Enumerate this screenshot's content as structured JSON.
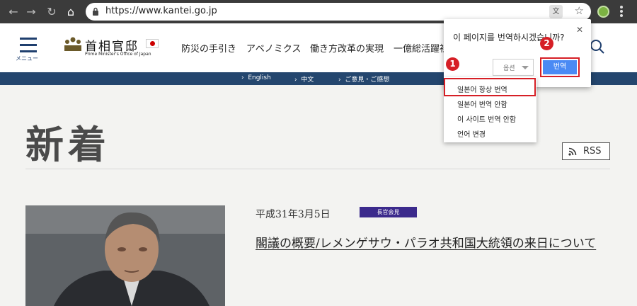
{
  "browser": {
    "url": "https://www.kantei.go.jp",
    "back_icon": "back-arrow-icon",
    "forward_icon": "forward-arrow-icon",
    "reload_icon": "reload-icon",
    "home_icon": "home-icon"
  },
  "header": {
    "menu_label": "メニュー",
    "logo_title": "首相官邸",
    "logo_subtitle": "Prime Minister's Office of Japan",
    "nav": [
      "防災の手引き",
      "アベノミクス",
      "働き方改革の実現",
      "一億総活躍社"
    ]
  },
  "subbar": {
    "links": [
      "English",
      "中文",
      "ご意見・ご感想"
    ]
  },
  "page": {
    "title": "新着",
    "rss_label": "RSS",
    "news": {
      "date": "平成31年3月5日",
      "tag": "長官会見",
      "title": "閣議の概要/レメンゲサウ・パラオ共和国大統領の来日について"
    }
  },
  "translate_popup": {
    "question": "이 페이지를 번역하시겠습니까?",
    "options_label": "옵션",
    "translate_label": "번역"
  },
  "dropdown": {
    "items": [
      "일본어 항상 번역",
      "일본어 번역 안함",
      "이 사이트 번역 안함",
      "언어 변경"
    ]
  },
  "badges": [
    "1",
    "2"
  ],
  "colors": {
    "chrome_bar": "#3b3b3b",
    "subbar": "#24466e",
    "highlight": "#d61f26",
    "translate_button": "#4a8af4",
    "news_tag": "#3b2a8c"
  }
}
